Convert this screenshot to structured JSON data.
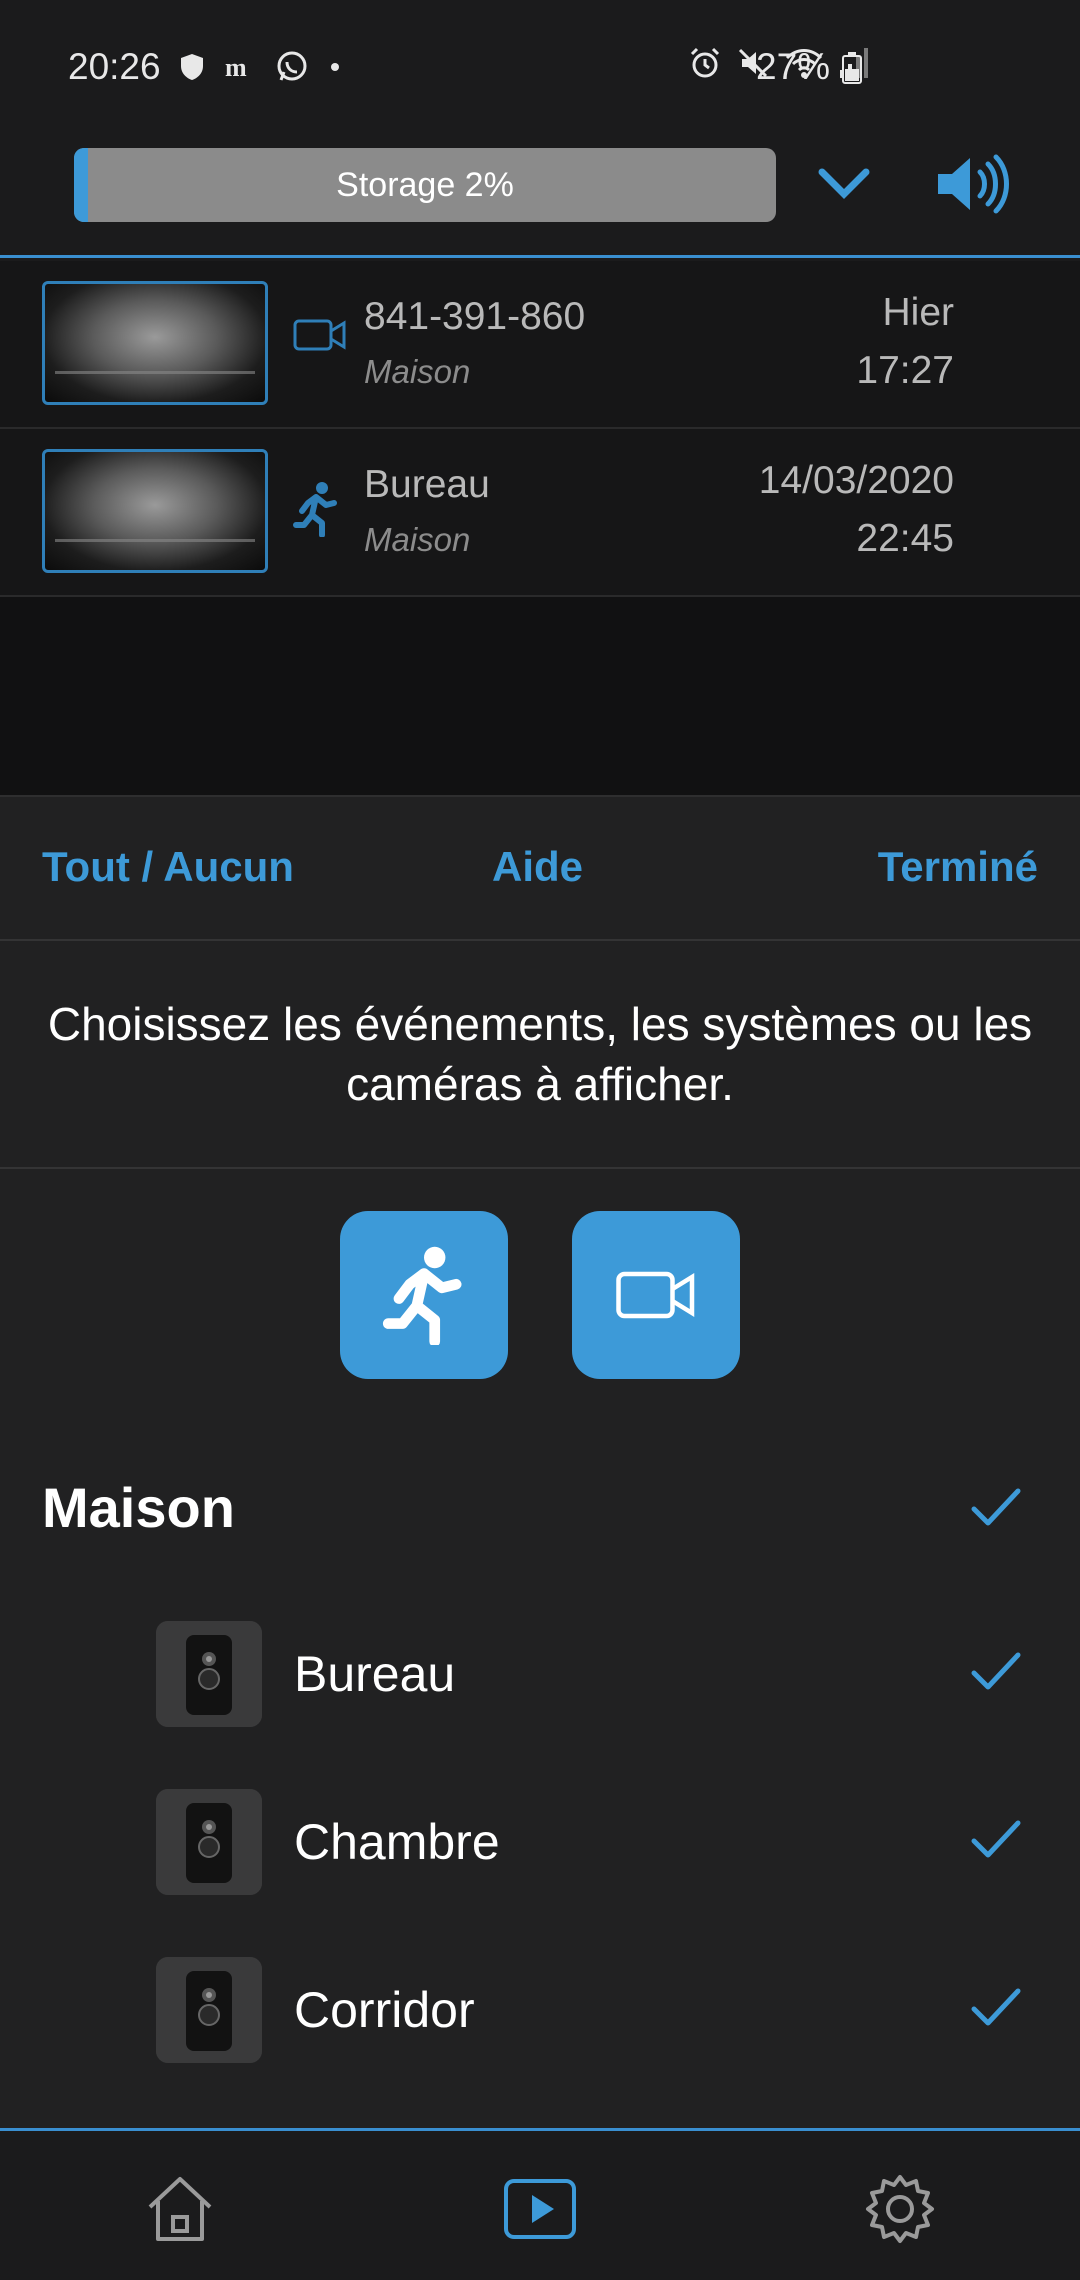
{
  "status_bar": {
    "time": "20:26",
    "battery": "27%",
    "icons_left": [
      "shield-icon",
      "newspaper-icon",
      "whatsapp-icon",
      "dot-icon"
    ],
    "icons_right": [
      "alarm-icon",
      "mute-icon",
      "wifi-icon",
      "signal-icon",
      "battery-icon"
    ]
  },
  "top_bar": {
    "storage_label": "Storage 2%",
    "storage_percent": 2,
    "accent_color": "#3d9ad8"
  },
  "events": [
    {
      "title": "841-391-860",
      "subtitle": "Maison",
      "date": "Hier",
      "time": "17:27",
      "type_icon": "video-camera-icon"
    },
    {
      "title": "Bureau",
      "subtitle": "Maison",
      "date": "14/03/2020",
      "time": "22:45",
      "type_icon": "motion-running-icon"
    }
  ],
  "actions": {
    "select_all": "Tout / Aucun",
    "help": "Aide",
    "done": "Terminé"
  },
  "instruction": "Choisissez les événements, les systèmes ou les caméras à afficher.",
  "filters": {
    "motion_icon": "motion-running-icon",
    "camera_icon": "video-camera-icon"
  },
  "group": {
    "title": "Maison",
    "cameras": [
      {
        "name": "Bureau"
      },
      {
        "name": "Chambre"
      },
      {
        "name": "Corridor"
      }
    ]
  },
  "bottom_nav": [
    "home-icon",
    "play-icon",
    "settings-icon"
  ]
}
